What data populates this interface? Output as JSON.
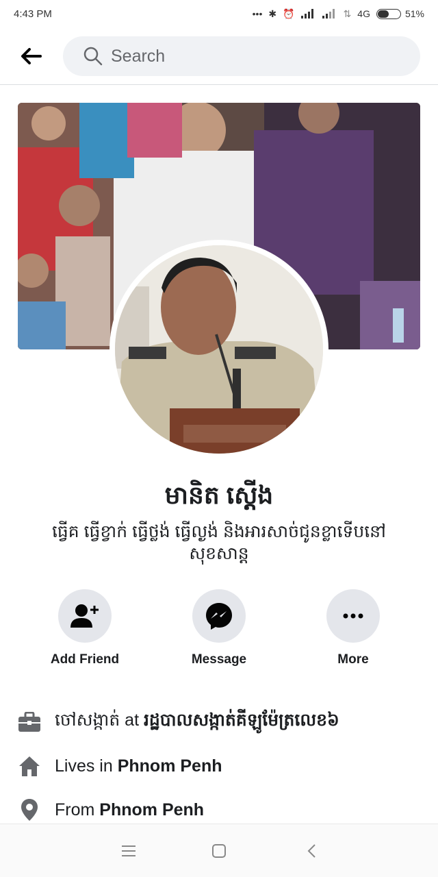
{
  "status_bar": {
    "time": "4:43 PM",
    "network": "4G",
    "battery_percent": "51%",
    "battery_level": 0.51
  },
  "top_bar": {
    "back_icon": "arrow-left-icon",
    "search_icon": "search-icon",
    "search_placeholder": "Search"
  },
  "profile": {
    "name": "មានិត ស្ដើង",
    "bio": "ធ្វើគ ធ្វើខ្វាក់ ធ្វើថ្លង់ ធ្វើល្ងង់ និងអារសាច់ជូនខ្លាទើបនៅសុខសាន្ត"
  },
  "actions": [
    {
      "label": "Add Friend",
      "icon": "add-friend-icon"
    },
    {
      "label": "Message",
      "icon": "messenger-icon"
    },
    {
      "label": "More",
      "icon": "more-dots-icon"
    }
  ],
  "info": {
    "work": {
      "icon": "briefcase-icon",
      "prefix": "ចៅសង្កាត់ at ",
      "value": "រដ្ឋបាលសង្កាត់គីឡូម៉ែត្រលេខ៦"
    },
    "lives": {
      "icon": "home-icon",
      "prefix": "Lives in ",
      "value": "Phnom Penh"
    },
    "from": {
      "icon": "location-pin-icon",
      "prefix": "From ",
      "value": "Phnom Penh"
    }
  },
  "nav_bar": {
    "menu_icon": "menu-icon",
    "home_icon": "square-home-icon",
    "back_icon": "chevron-back-icon"
  },
  "colors": {
    "action_bg": "#e4e6eb",
    "search_bg": "#f0f2f5",
    "icon_gray": "#65676b"
  }
}
